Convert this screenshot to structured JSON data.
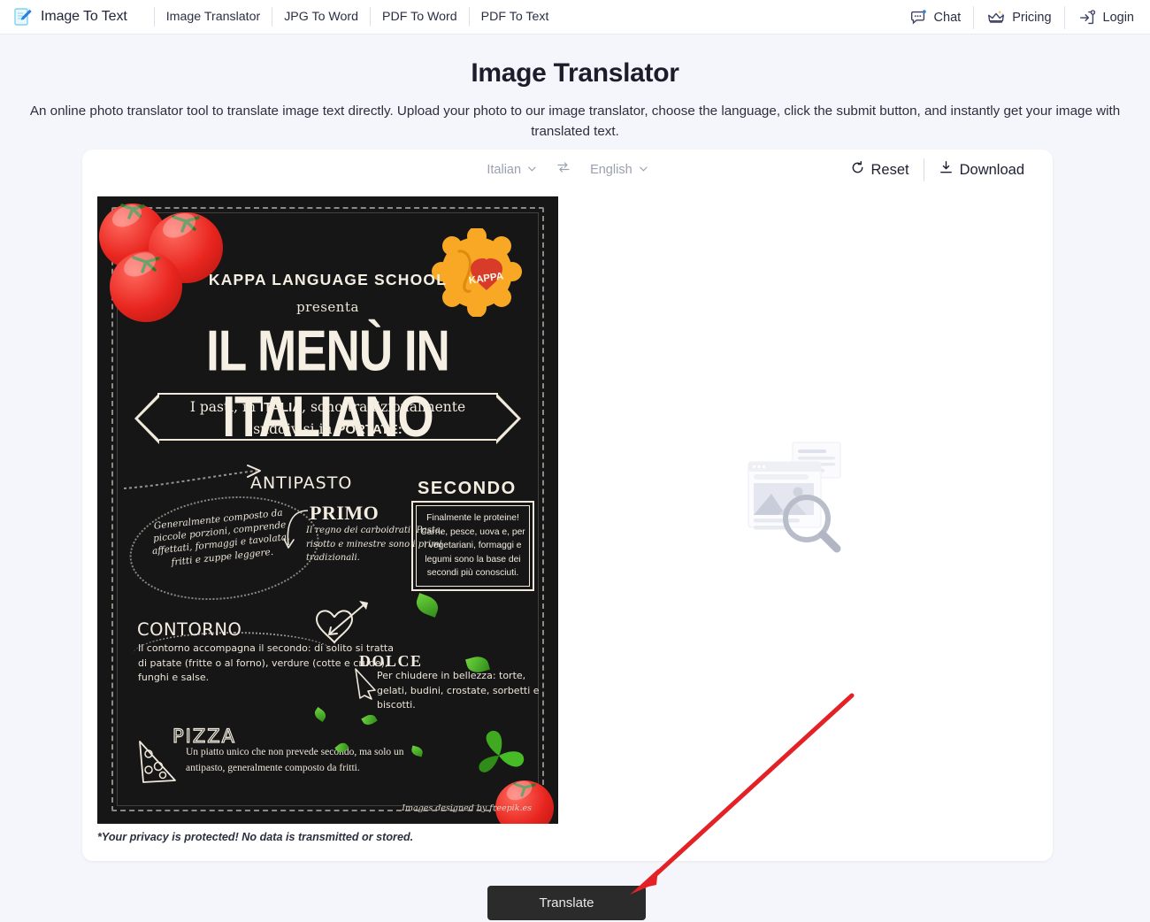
{
  "header": {
    "brand": "Image To Text",
    "brand_icon": "document-pencil-icon",
    "nav": [
      {
        "label": "Image Translator",
        "name": "nav-image-translator"
      },
      {
        "label": "JPG To Word",
        "name": "nav-jpg-to-word"
      },
      {
        "label": "PDF To Word",
        "name": "nav-pdf-to-word"
      },
      {
        "label": "PDF To Text",
        "name": "nav-pdf-to-text"
      }
    ],
    "actions": [
      {
        "label": "Chat",
        "icon": "chat-bubble-icon"
      },
      {
        "label": "Pricing",
        "icon": "crown-icon"
      },
      {
        "label": "Login",
        "icon": "login-arrow-icon"
      }
    ]
  },
  "page": {
    "title": "Image Translator",
    "description": "An online photo translator tool to translate image text directly. Upload your photo to our image translator, choose the language, click the submit button, and instantly get your image with translated text."
  },
  "toolbar": {
    "source_language": "Italian",
    "target_language": "English",
    "swap_icon": "swap-arrows-icon",
    "chevron_icon": "chevron-down-icon",
    "reset_label": "Reset",
    "reset_icon": "reset-circular-arrow-icon",
    "download_label": "Download",
    "download_icon": "download-tray-icon"
  },
  "poster": {
    "school_name": "KAPPA LANGUAGE SCHOOL",
    "presenta": "presenta",
    "title": "IL MENÙ IN ITALIANO",
    "ribbon_line1_a": "I pasti, in ",
    "ribbon_line1_b": "ITALIA",
    "ribbon_line1_c": ", sono tradizionalmente",
    "ribbon_line2_a": "suddivisi in ",
    "ribbon_line2_b": "PORTATE:",
    "badge_text": "KAPPA",
    "sections": {
      "antipasto": {
        "heading": "ANTIPASTO",
        "text": "Generalmente composto da piccole porzioni, comprende affettati, formaggi e tavolata, fritti e zuppe leggere."
      },
      "primo": {
        "heading": "PRIMO",
        "text": "Il regno dei carboidrati. Pasta, risotto e minestre sono i primi tradizionali."
      },
      "secondo": {
        "heading": "SECONDO",
        "text": "Finalmente le proteine! Carne, pesce, uova e, per i vegetariani, formaggi e legumi sono la base dei secondi più conosciuti."
      },
      "contorno": {
        "heading": "CONTORNO",
        "text": "Il contorno accompagna il secondo: di solito si tratta di patate (fritte o al forno), verdure (cotte e crude), funghi e salse."
      },
      "dolce": {
        "heading": "DOLCE",
        "text": "Per chiudere in bellezza: torte, gelati, budini, crostate, sorbetti e biscotti."
      },
      "pizza": {
        "heading": "PIZZA",
        "text": "Un piatto unico che non prevede secondo, ma solo un antipasto, generalmente composto da fritti."
      }
    },
    "credit": "Images designed by freepik.es"
  },
  "privacy_note": "*Your privacy is protected! No data is transmitted or stored.",
  "placeholder_icon": "image-search-placeholder-icon",
  "translate_button": "Translate",
  "annotation": {
    "arrow_color": "#e32228",
    "arrow_from": "965,785",
    "arrow_to": "716,1009"
  },
  "colors": {
    "page_background": "#f5f6fb",
    "header_background": "#ffffff",
    "card_background": "#ffffff",
    "poster_background": "#161616",
    "button_background": "#2b2b2b",
    "badge_orange": "#f9a825",
    "badge_red": "#d93b2b"
  }
}
